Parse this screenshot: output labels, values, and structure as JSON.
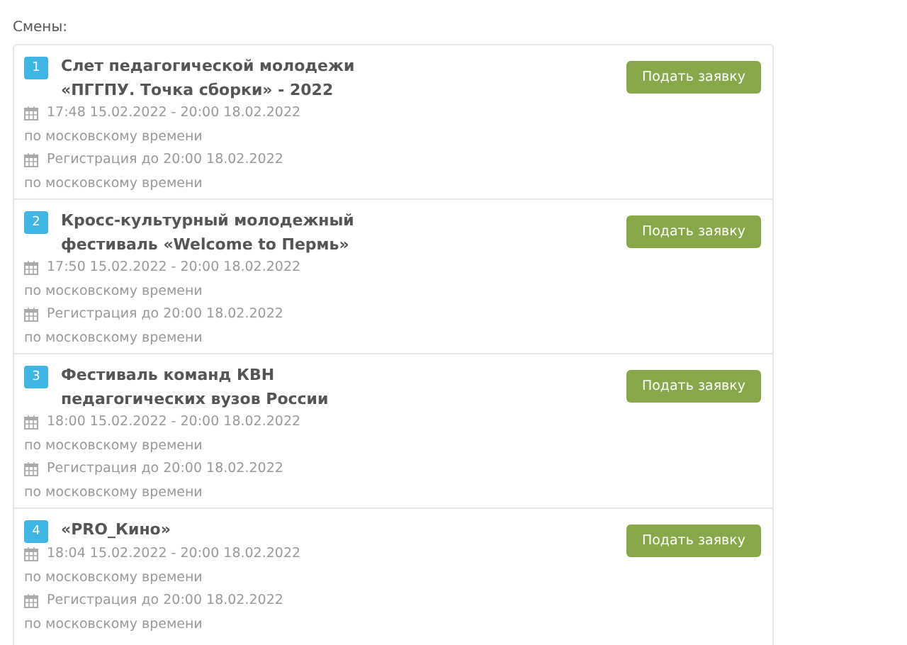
{
  "section_label": "Смены:",
  "shifts": [
    {
      "number": "1",
      "title_lines": [
        "Слет педагогической молодежи",
        "«ПГГПУ. Точка сборки» - 2022"
      ],
      "period": "17:48 15.02.2022 - 20:00 18.02.2022",
      "period_note": "по московскому времени",
      "registration": "Регистрация до 20:00 18.02.2022",
      "registration_note": "по московскому времени",
      "button": "Подать заявку"
    },
    {
      "number": "2",
      "title_lines": [
        "Кросс-культурный молодежный",
        "фестиваль «Welcome to Пермь»"
      ],
      "period": "17:50 15.02.2022 - 20:00 18.02.2022",
      "period_note": "по московскому времени",
      "registration": "Регистрация до 20:00 18.02.2022",
      "registration_note": "по московскому времени",
      "button": "Подать заявку"
    },
    {
      "number": "3",
      "title_lines": [
        "Фестиваль команд КВН",
        "педагогических вузов России"
      ],
      "period": "18:00 15.02.2022 - 20:00 18.02.2022",
      "period_note": "по московскому времени",
      "registration": "Регистрация до 20:00 18.02.2022",
      "registration_note": "по московскому времени",
      "button": "Подать заявку"
    },
    {
      "number": "4",
      "title_lines": [
        "«PRO_Кино»"
      ],
      "period": "18:04 15.02.2022 - 20:00 18.02.2022",
      "period_note": "по московскому времени",
      "registration": "Регистрация до 20:00 18.02.2022",
      "registration_note": "по московскому времени",
      "button": "Подать заявку"
    }
  ]
}
